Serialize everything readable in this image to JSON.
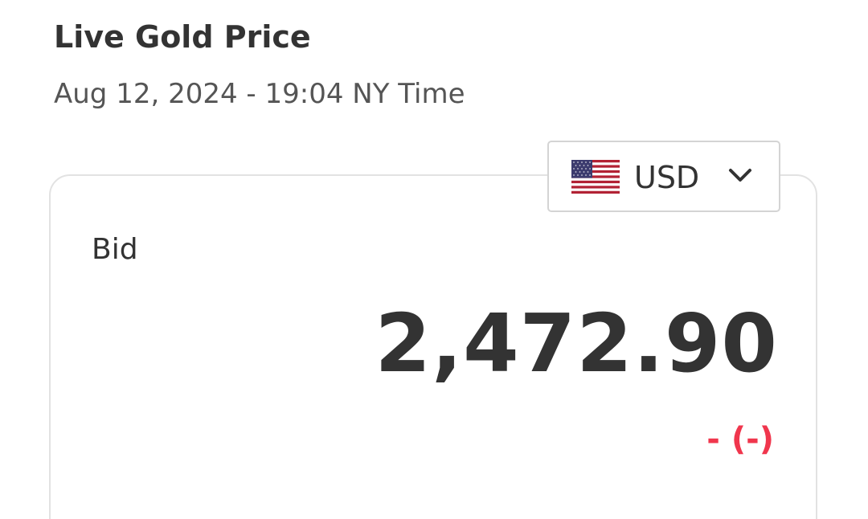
{
  "header": {
    "title": "Live Gold Price",
    "timestamp": "Aug 12, 2024 - 19:04 NY Time"
  },
  "currency_selector": {
    "selected": "USD",
    "flag_icon": "us-flag-icon",
    "dropdown_icon": "chevron-down-icon"
  },
  "price_card": {
    "bid_label": "Bid",
    "bid_value": "2,472.90",
    "change_text": "- (-)"
  },
  "colors": {
    "text": "#333333",
    "subtext": "#555555",
    "change_negative": "#f0364d",
    "card_border": "#e2e2e2"
  }
}
